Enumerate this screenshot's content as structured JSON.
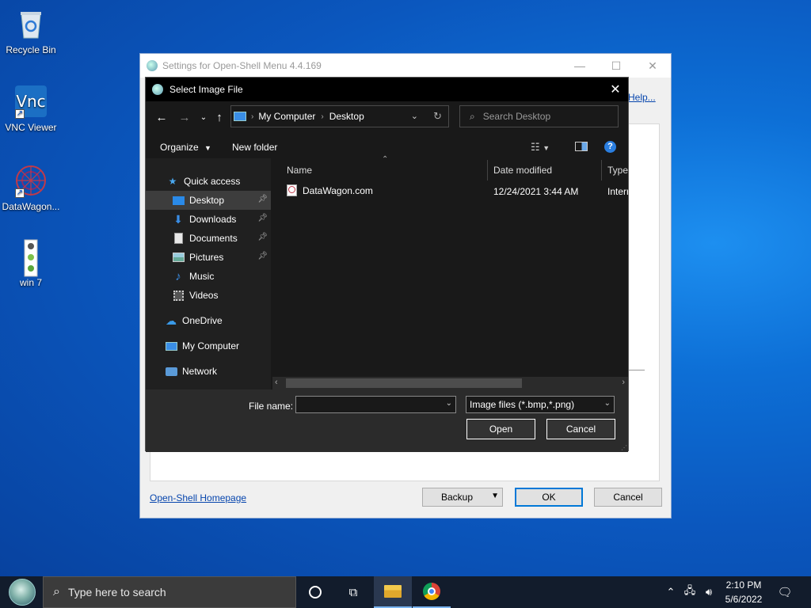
{
  "desktop": {
    "icons": [
      {
        "label": "Recycle Bin"
      },
      {
        "label": "VNC Viewer"
      },
      {
        "label": "DataWagon..."
      },
      {
        "label": "win 7"
      }
    ]
  },
  "settings_window": {
    "title": "Settings for Open-Shell Menu 4.4.169",
    "help_link": "Help...",
    "homepage_link": "Open-Shell Homepage",
    "backup_label": "Backup",
    "ok_label": "OK",
    "cancel_label": "Cancel"
  },
  "dialog": {
    "title": "Select Image File",
    "breadcrumb": [
      "My Computer",
      "Desktop"
    ],
    "search_placeholder": "Search Desktop",
    "organize_label": "Organize",
    "new_folder_label": "New folder",
    "nav": {
      "quick_access": "Quick access",
      "items": [
        {
          "label": "Desktop",
          "pinned": true,
          "selected": true
        },
        {
          "label": "Downloads",
          "pinned": true
        },
        {
          "label": "Documents",
          "pinned": true
        },
        {
          "label": "Pictures",
          "pinned": true
        },
        {
          "label": "Music"
        },
        {
          "label": "Videos"
        }
      ],
      "onedrive": "OneDrive",
      "my_computer": "My Computer",
      "network": "Network"
    },
    "columns": {
      "name": "Name",
      "date": "Date modified",
      "type": "Type"
    },
    "files": [
      {
        "name": "DataWagon.com",
        "date": "12/24/2021 3:44 AM",
        "type": "Interr"
      }
    ],
    "file_name_label": "File name:",
    "file_name_value": "",
    "filter_value": "Image files (*.bmp,*.png)",
    "open_label": "Open",
    "cancel_label": "Cancel"
  },
  "taskbar": {
    "search_placeholder": "Type here to search",
    "time": "2:10 PM",
    "date": "5/6/2022"
  },
  "colors": {
    "dialog_bg": "#191919",
    "accent": "#0078d7",
    "link": "#0645ad"
  }
}
